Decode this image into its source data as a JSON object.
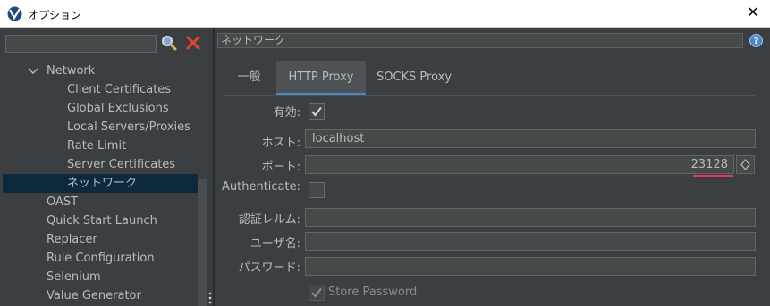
{
  "window": {
    "title": "オプション"
  },
  "sidebar": {
    "search_value": "",
    "items": [
      {
        "label": "Network",
        "level": 1,
        "expanded": true
      },
      {
        "label": "Client Certificates",
        "level": 2
      },
      {
        "label": "Global Exclusions",
        "level": 2
      },
      {
        "label": "Local Servers/Proxies",
        "level": 2
      },
      {
        "label": "Rate Limit",
        "level": 2
      },
      {
        "label": "Server Certificates",
        "level": 2
      },
      {
        "label": "ネットワーク",
        "level": 2,
        "selected": true
      },
      {
        "label": "OAST",
        "level": 1
      },
      {
        "label": "Quick Start Launch",
        "level": 1
      },
      {
        "label": "Replacer",
        "level": 1
      },
      {
        "label": "Rule Configuration",
        "level": 1
      },
      {
        "label": "Selenium",
        "level": 1
      },
      {
        "label": "Value Generator",
        "level": 1
      }
    ]
  },
  "panel": {
    "title": "ネットワーク",
    "tabs": [
      {
        "label": "一般",
        "active": false
      },
      {
        "label": "HTTP Proxy",
        "active": true
      },
      {
        "label": "SOCKS Proxy",
        "active": false
      }
    ],
    "form": {
      "enabled_label": "有効:",
      "enabled_checked": true,
      "host_label": "ホスト:",
      "host_value": "localhost",
      "port_label": "ポート:",
      "port_value": "23128",
      "authenticate_label": "Authenticate:",
      "authenticate_checked": false,
      "realm_label": "認証レルム:",
      "realm_value": "",
      "username_label": "ユーザ名:",
      "username_value": "",
      "password_label": "パスワード:",
      "password_value": "",
      "store_password_label": "Store Password",
      "store_password_checked": true
    }
  },
  "colors": {
    "accent": "#4a88c7",
    "selection": "#0d293e",
    "highlight_underline": "#e8365d",
    "clear_icon": "#e0442a"
  }
}
